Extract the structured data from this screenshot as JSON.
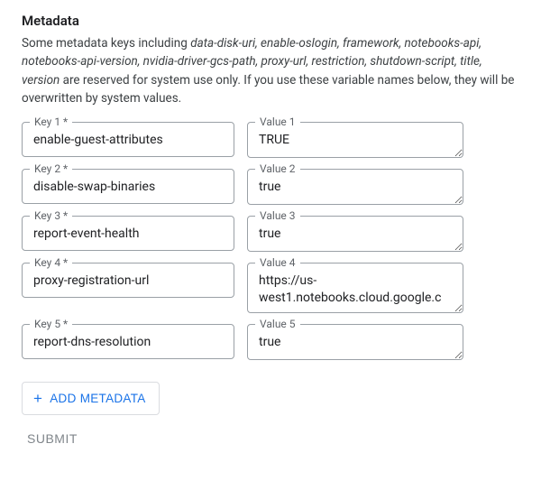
{
  "heading": "Metadata",
  "description": {
    "prefix": "Some metadata keys including ",
    "reserved_list": "data-disk-uri, enable-oslogin, framework, notebooks-api, notebooks-api-version, nvidia-driver-gcs-path, proxy-url, restriction, shutdown-script, title, version",
    "suffix": " are reserved for system use only. If you use these variable names below, they will be overwritten by system values."
  },
  "labels": {
    "key": [
      "Key 1 *",
      "Key 2 *",
      "Key 3 *",
      "Key 4 *",
      "Key 5 *"
    ],
    "value": [
      "Value 1",
      "Value 2",
      "Value 3",
      "Value 4",
      "Value 5"
    ]
  },
  "rows": [
    {
      "key": "enable-guest-attributes",
      "value": "TRUE"
    },
    {
      "key": "disable-swap-binaries",
      "value": "true"
    },
    {
      "key": "report-event-health",
      "value": "true"
    },
    {
      "key": "proxy-registration-url",
      "value": "https://us-west1.notebooks.cloud.google.c"
    },
    {
      "key": "report-dns-resolution",
      "value": "true"
    }
  ],
  "buttons": {
    "add": "ADD METADATA",
    "submit": "SUBMIT"
  }
}
